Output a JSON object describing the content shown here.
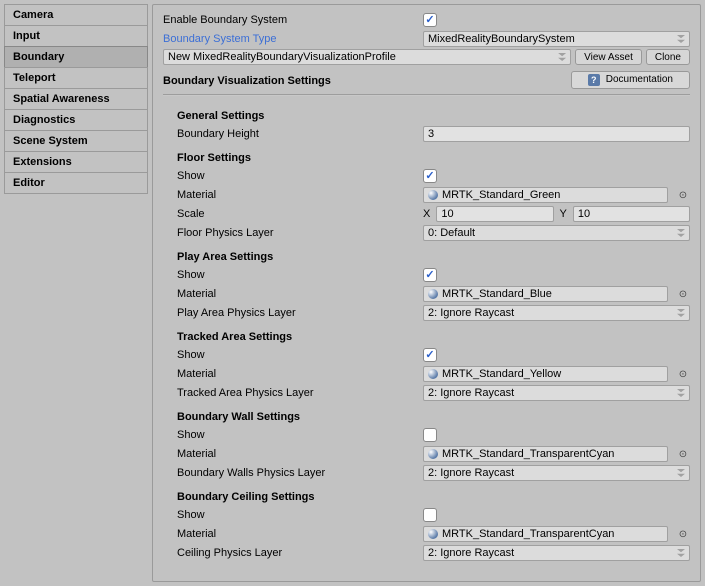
{
  "sidebar": {
    "items": [
      {
        "label": "Camera"
      },
      {
        "label": "Input"
      },
      {
        "label": "Boundary",
        "selected": true
      },
      {
        "label": "Teleport"
      },
      {
        "label": "Spatial Awareness"
      },
      {
        "label": "Diagnostics"
      },
      {
        "label": "Scene System"
      },
      {
        "label": "Extensions"
      },
      {
        "label": "Editor"
      }
    ]
  },
  "header": {
    "enable_label": "Enable Boundary System",
    "enable_checked": true,
    "type_label": "Boundary System Type",
    "type_value": "MixedRealityBoundarySystem",
    "profile_value": "New MixedRealityBoundaryVisualizationProfile",
    "view_asset_btn": "View Asset",
    "clone_btn": "Clone",
    "vis_title": "Boundary Visualization Settings",
    "doc_btn": "Documentation"
  },
  "general": {
    "title": "General Settings",
    "height_label": "Boundary Height",
    "height_value": "3"
  },
  "floor": {
    "title": "Floor Settings",
    "show_label": "Show",
    "show_checked": true,
    "material_label": "Material",
    "material_value": "MRTK_Standard_Green",
    "scale_label": "Scale",
    "scale_x_label": "X",
    "scale_x": "10",
    "scale_y_label": "Y",
    "scale_y": "10",
    "layer_label": "Floor Physics Layer",
    "layer_value": "0: Default"
  },
  "playarea": {
    "title": "Play Area Settings",
    "show_label": "Show",
    "show_checked": true,
    "material_label": "Material",
    "material_value": "MRTK_Standard_Blue",
    "layer_label": "Play Area Physics Layer",
    "layer_value": "2: Ignore Raycast"
  },
  "tracked": {
    "title": "Tracked Area Settings",
    "show_label": "Show",
    "show_checked": true,
    "material_label": "Material",
    "material_value": "MRTK_Standard_Yellow",
    "layer_label": "Tracked Area Physics Layer",
    "layer_value": "2: Ignore Raycast"
  },
  "wall": {
    "title": "Boundary Wall Settings",
    "show_label": "Show",
    "show_checked": false,
    "material_label": "Material",
    "material_value": "MRTK_Standard_TransparentCyan",
    "layer_label": "Boundary Walls Physics Layer",
    "layer_value": "2: Ignore Raycast"
  },
  "ceiling": {
    "title": "Boundary Ceiling Settings",
    "show_label": "Show",
    "show_checked": false,
    "material_label": "Material",
    "material_value": "MRTK_Standard_TransparentCyan",
    "layer_label": "Ceiling Physics Layer",
    "layer_value": "2: Ignore Raycast"
  }
}
